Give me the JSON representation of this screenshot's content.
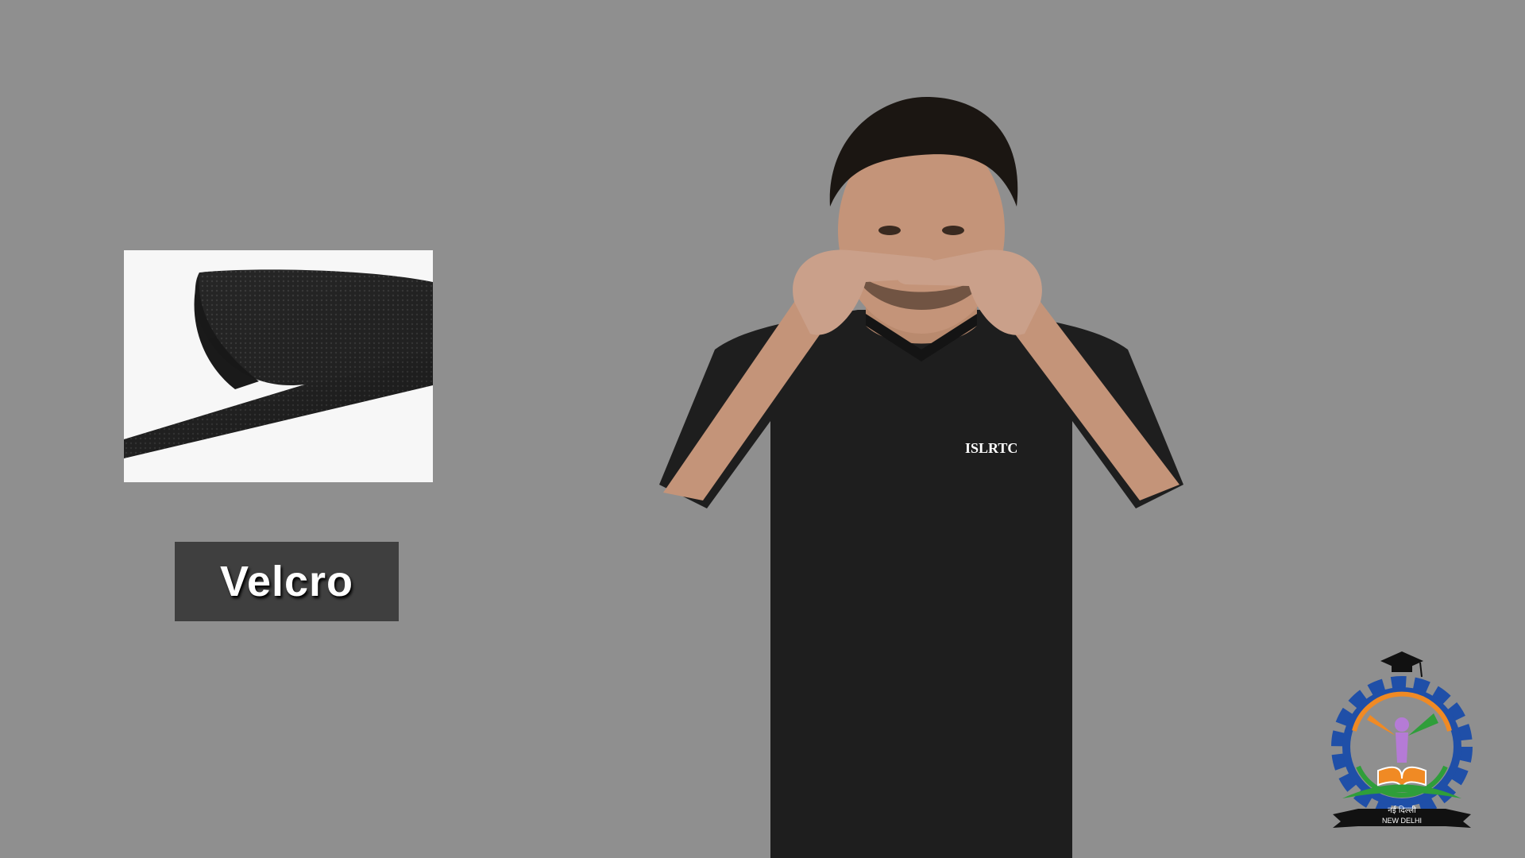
{
  "word_label": "Velcro",
  "shirt_text": "ISLRTC",
  "logo": {
    "city_hindi": "नई दिल्ली",
    "city_english": "NEW DELHI"
  },
  "colors": {
    "background": "#8f8f8f",
    "label_box": "#3f3f3f",
    "label_text": "#ffffff",
    "shirt": "#1e1e1e",
    "logo_gear": "#1f4fa8",
    "logo_saffron": "#f08a24",
    "logo_green": "#2f9e3a",
    "logo_figure": "#b57bd6"
  },
  "icons": [
    "velcro-photo",
    "signer-figure",
    "islrtc-logo",
    "graduation-cap-icon"
  ]
}
